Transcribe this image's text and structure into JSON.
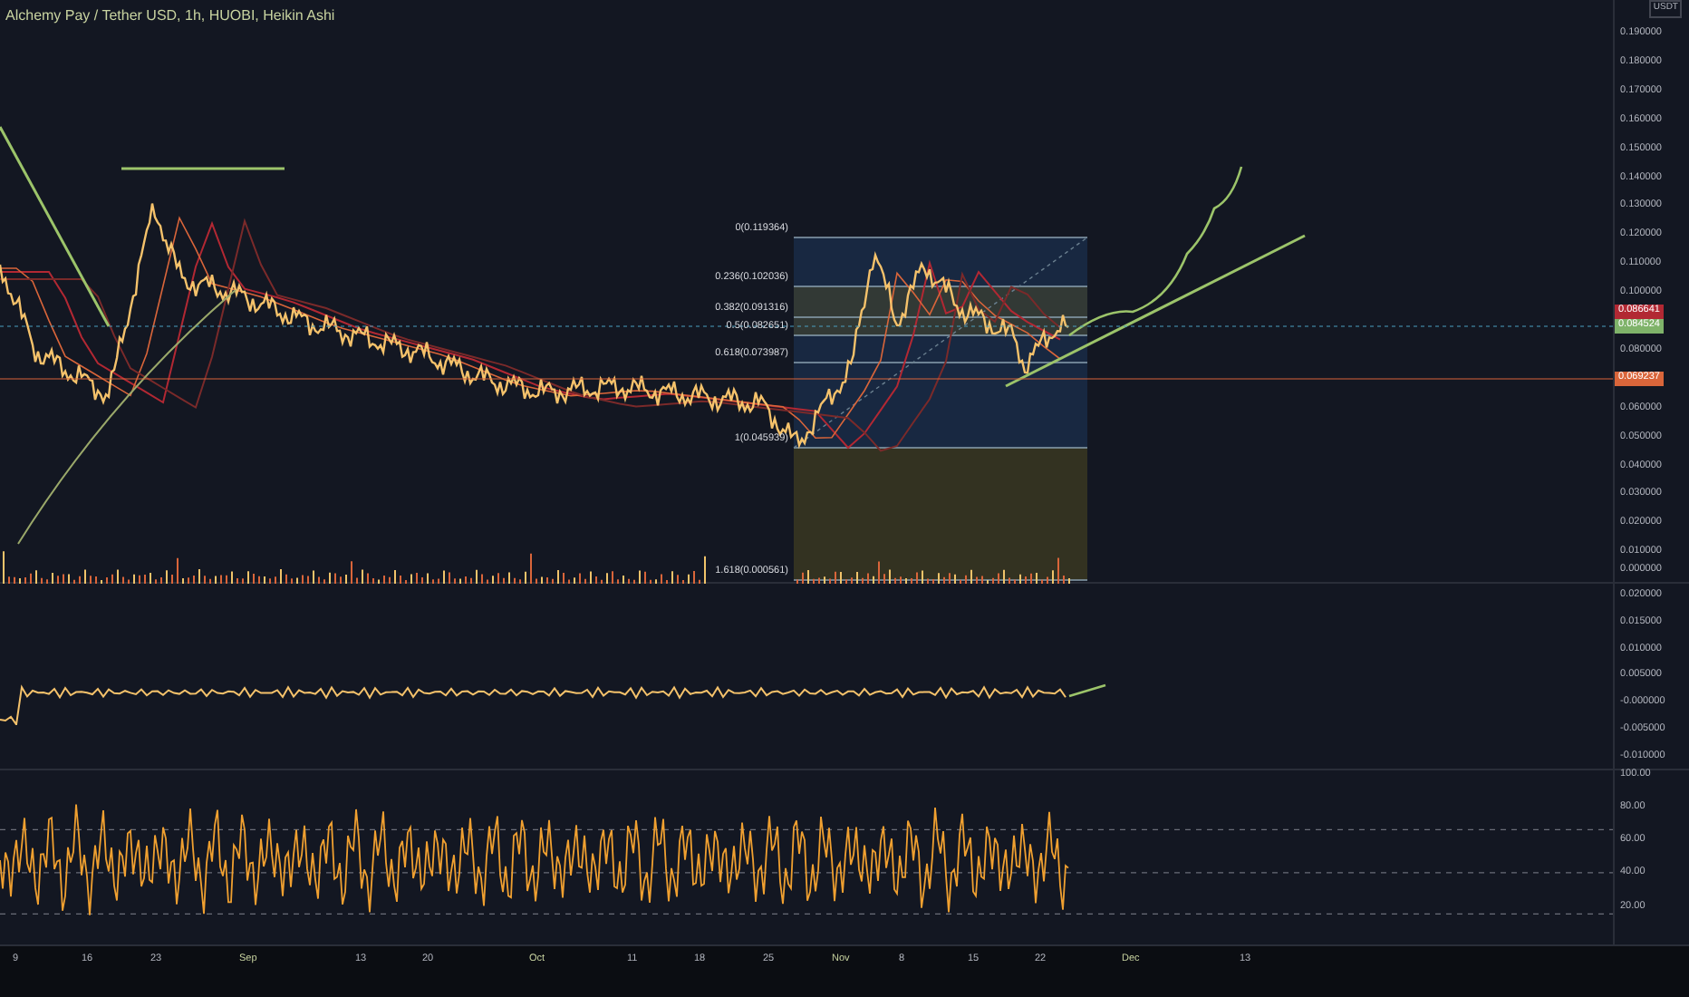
{
  "title": "Alchemy Pay / Tether USD, 1h, HUOBI, Heikin Ashi",
  "price_axis": {
    "unit": "USDT",
    "labels": [
      "0.190000",
      "0.180000",
      "0.170000",
      "0.160000",
      "0.150000",
      "0.140000",
      "0.130000",
      "0.120000",
      "0.110000",
      "0.100000",
      "0.080000",
      "0.060000",
      "0.050000",
      "0.040000",
      "0.030000",
      "0.020000",
      "0.010000",
      "0.000000"
    ]
  },
  "price_badges": [
    {
      "text": "0.086641",
      "color": "#b22833"
    },
    {
      "text": "0.084524",
      "color": "#7fb36a"
    },
    {
      "text": "0.069237",
      "color": "#d9653a"
    }
  ],
  "fib_levels": [
    {
      "label": "0(0.119364)"
    },
    {
      "label": "0.236(0.102036)"
    },
    {
      "label": "0.382(0.091316)"
    },
    {
      "label": "0.5(0.082651)"
    },
    {
      "label": "0.618(0.073987)"
    },
    {
      "label": "1(0.045939)"
    },
    {
      "label": "1.618(0.000561)"
    }
  ],
  "oscillator_axis": {
    "labels": [
      "0.020000",
      "0.015000",
      "0.010000",
      "0.005000",
      "-0.000000",
      "-0.005000",
      "-0.010000"
    ]
  },
  "rsi_axis": {
    "labels": [
      "100.00",
      "80.00",
      "60.00",
      "40.00",
      "20.00"
    ]
  },
  "time_axis": [
    {
      "label": "9",
      "kind": "day"
    },
    {
      "label": "16",
      "kind": "day"
    },
    {
      "label": "23",
      "kind": "day"
    },
    {
      "label": "Sep",
      "kind": "month"
    },
    {
      "label": "13",
      "kind": "day"
    },
    {
      "label": "20",
      "kind": "day"
    },
    {
      "label": "Oct",
      "kind": "month"
    },
    {
      "label": "11",
      "kind": "day"
    },
    {
      "label": "18",
      "kind": "day"
    },
    {
      "label": "25",
      "kind": "day"
    },
    {
      "label": "Nov",
      "kind": "month"
    },
    {
      "label": "8",
      "kind": "day"
    },
    {
      "label": "15",
      "kind": "day"
    },
    {
      "label": "22",
      "kind": "day"
    },
    {
      "label": "Dec",
      "kind": "month"
    },
    {
      "label": "13",
      "kind": "day"
    }
  ]
}
